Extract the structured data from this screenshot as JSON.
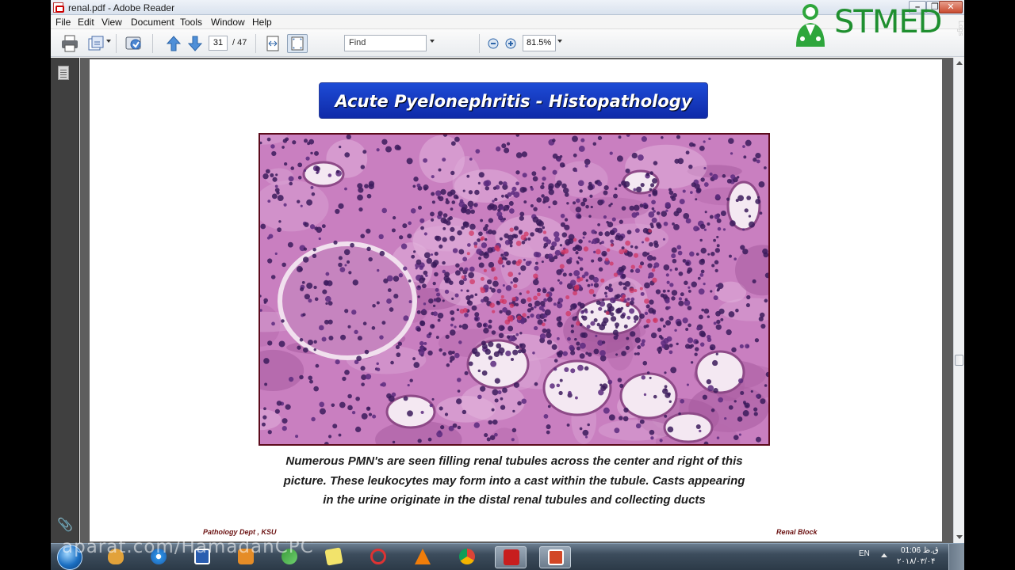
{
  "window": {
    "title": "renal.pdf - Adobe Reader",
    "minimize_glyph": "–",
    "restore_glyph": "❐",
    "close_glyph": "✕"
  },
  "menu": {
    "items": [
      "File",
      "Edit",
      "View",
      "Document",
      "Tools",
      "Window",
      "Help"
    ]
  },
  "toolbar": {
    "page_current": "31",
    "page_total": "/ 47",
    "find_placeholder": "Find",
    "zoom": "81.5%"
  },
  "logo": {
    "brand": "STMED",
    "side_text": "Logs"
  },
  "slide": {
    "title": "Acute Pyelonephritis - Histopathology",
    "caption_line1": "Numerous PMN's are seen filling renal tubules across the center and right of this",
    "caption_line2": "picture. These leukocytes may form into a cast within the tubule. Casts appearing",
    "caption_line3": "in the urine originate in the distal renal tubules and collecting ducts",
    "footer_left": "Pathology Dept , KSU",
    "footer_right": "Renal   Block"
  },
  "taskbar": {
    "watermark": "aparat.com/HamadanCPC",
    "lang": "EN",
    "time": "01:06 ق.ظ",
    "date": "۲۰۱۸/۰۳/۰۴",
    "apps": [
      "winamp-icon",
      "internet-explorer-icon",
      "word-icon",
      "media-player-icon",
      "app-icon",
      "sticky-notes-icon",
      "snipping-tool-icon",
      "vlc-icon",
      "chrome-icon",
      "adobe-reader-icon",
      "powerpoint-icon"
    ]
  },
  "colors": {
    "title_bar_blue": "#0f2aa8",
    "stain_pink": "#c97fc0",
    "nucleus_purple": "#3b1b5c",
    "brand_green": "#1f8f2f"
  }
}
